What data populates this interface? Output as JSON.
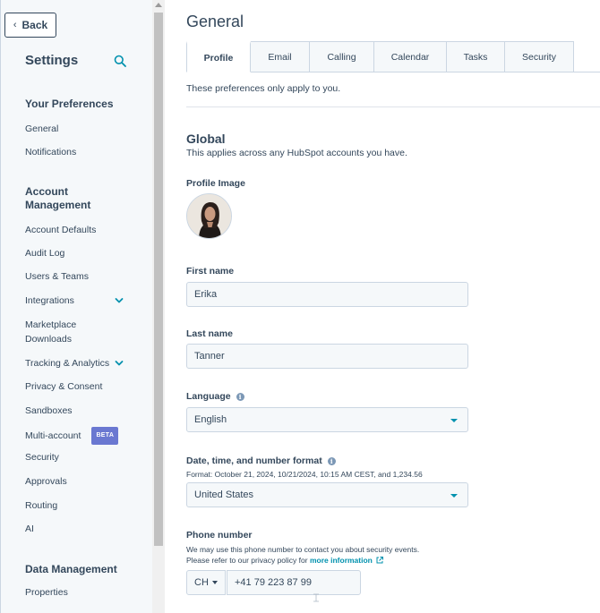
{
  "sidebar": {
    "back_label": "Back",
    "title": "Settings",
    "sections": [
      {
        "heading": "Your Preferences",
        "items": [
          "General",
          "Notifications"
        ]
      },
      {
        "heading": "Account Management",
        "items": [
          "Account Defaults",
          "Audit Log",
          "Users & Teams",
          "Integrations",
          "Marketplace Downloads",
          "Tracking & Analytics",
          "Privacy & Consent",
          "Sandboxes",
          "Multi-account",
          "Security",
          "Approvals",
          "Routing",
          "AI"
        ]
      },
      {
        "heading": "Data Management",
        "items": [
          "Properties"
        ]
      }
    ],
    "beta_badge": "BETA"
  },
  "main": {
    "title": "General",
    "tabs": [
      "Profile",
      "Email",
      "Calling",
      "Calendar",
      "Tasks",
      "Security"
    ],
    "active_tab": "Profile",
    "tab_note": "These preferences only apply to you.",
    "global": {
      "title": "Global",
      "subtitle": "This applies across any HubSpot accounts you have."
    },
    "profile_image_label": "Profile Image",
    "first_name": {
      "label": "First name",
      "value": "Erika"
    },
    "last_name": {
      "label": "Last name",
      "value": "Tanner"
    },
    "language": {
      "label": "Language",
      "value": "English"
    },
    "date_format": {
      "label": "Date, time, and number format",
      "note": "Format: October 21, 2024, 10/21/2024, 10:15 AM CEST, and 1,234.56",
      "value": "United States"
    },
    "phone": {
      "label": "Phone number",
      "note_line1": "We may use this phone number to contact you about security events.",
      "note_line2": "Please refer to our privacy policy for",
      "note_link": "more information",
      "country_code": "CH",
      "value": "+41 79 223 87 99"
    }
  },
  "colors": {
    "text": "#33475b",
    "accent": "#0091ae",
    "sidebar_bg": "#f5f8fa",
    "input_bg": "#f5f8fa",
    "border": "#cbd6e2",
    "beta": "#6a78d1"
  }
}
